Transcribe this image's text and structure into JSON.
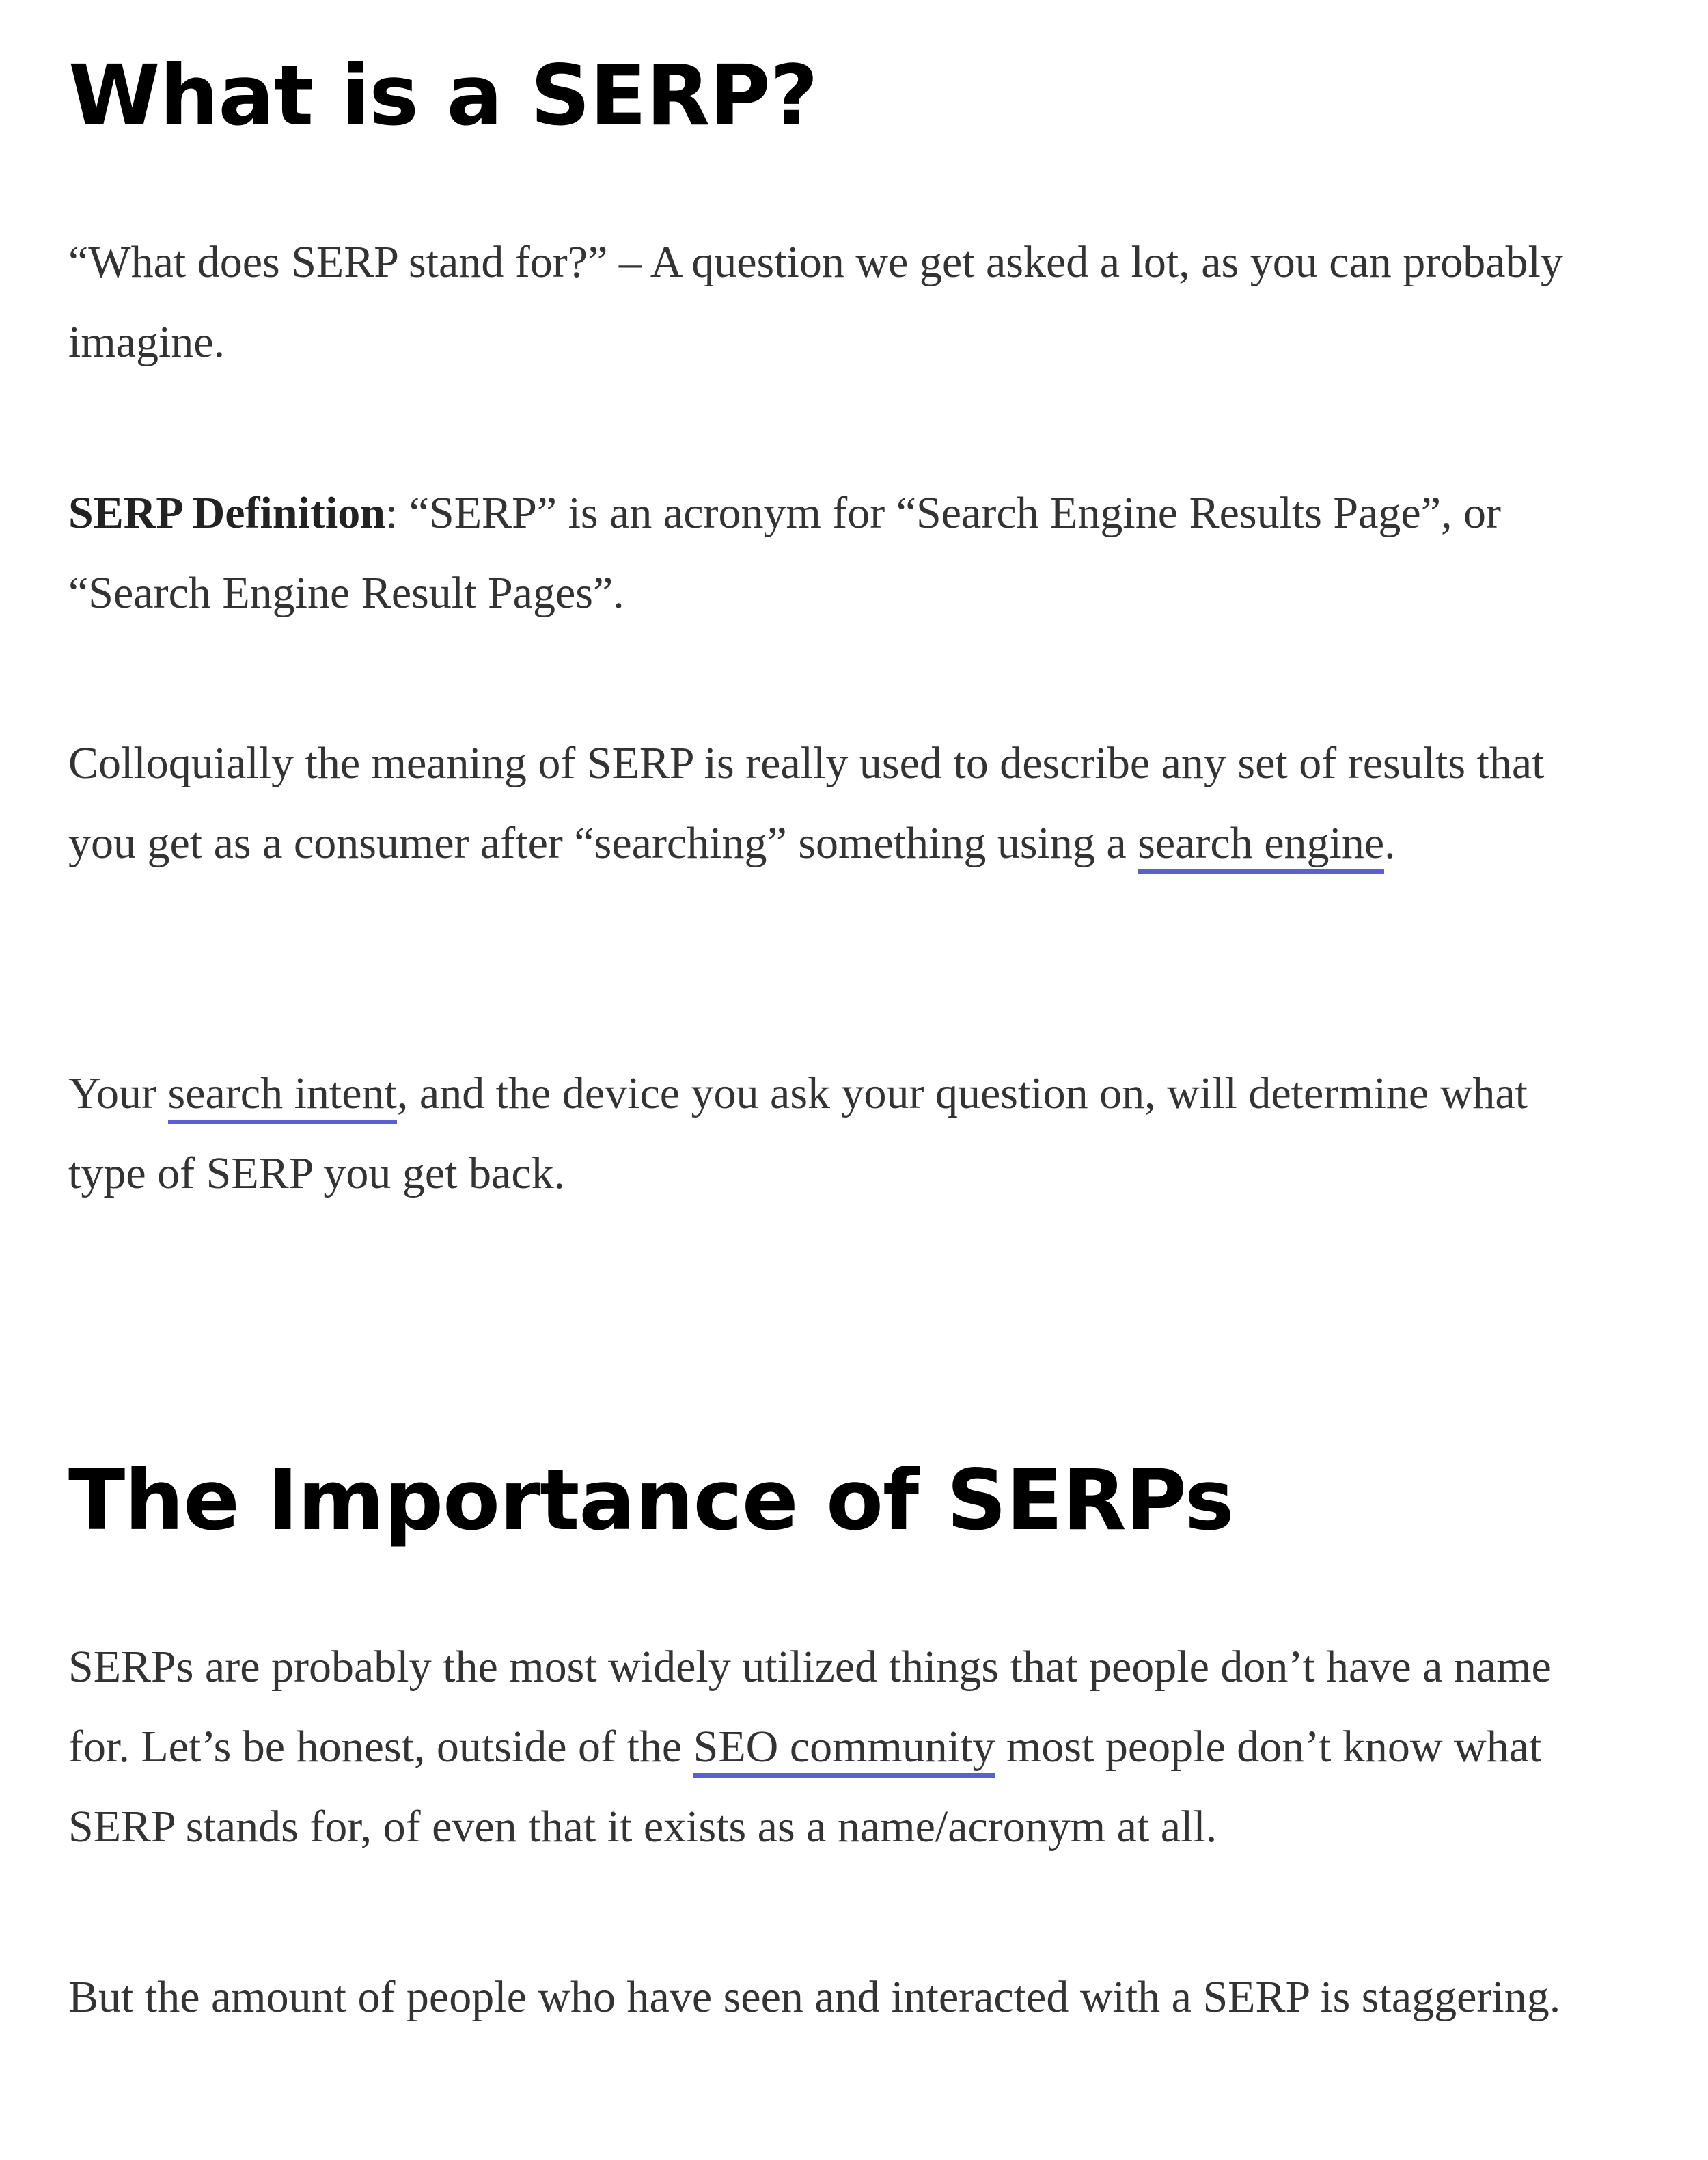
{
  "headings": {
    "what_is": "What is a SERP?",
    "importance": "The Importance of SERPs"
  },
  "paragraphs": {
    "p1": "“What does SERP stand for?” – A question we get asked a lot, as you can probably imagine.",
    "p2_bold": "SERP Definition",
    "p2_rest": ": “SERP” is an acronym for “Search Engine Results Page”, or “Search Engine Result Pages”.",
    "p3_before": "Colloquially the meaning of SERP is really used to describe any set of results that you get as a consumer after “searching” something using a ",
    "p3_link": "search engine",
    "p3_after": ".",
    "p4_before": "Your ",
    "p4_link": "search intent",
    "p4_after": ", and the device you ask your question on, will determine what type of SERP you get back.",
    "p5_before": "SERPs are probably the most widely utilized things that people don’t have a name for. Let’s be honest, outside of the ",
    "p5_link": "SEO community",
    "p5_after": " most people don’t know what SERP stands for, of even that it exists as a name/acronym at all.",
    "p6": "But the amount of people who have seen and interacted with a SERP is staggering."
  },
  "colors": {
    "link_underline": "#5b5fd6",
    "body_text": "#333333",
    "heading_text": "#000000"
  }
}
